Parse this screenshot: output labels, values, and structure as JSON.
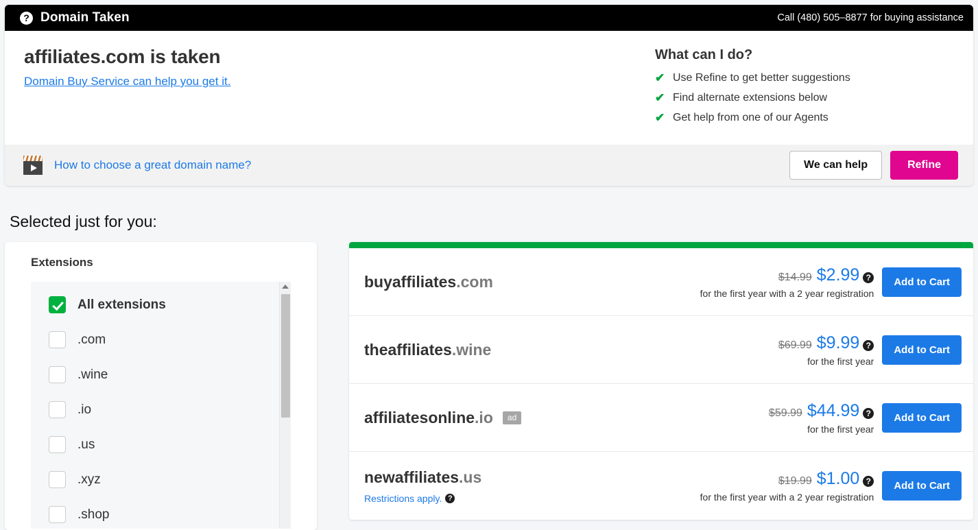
{
  "header": {
    "icon": "question-circle-icon",
    "title": "Domain Taken",
    "phone_text": "Call (480) 505–8877 for buying assistance"
  },
  "hero": {
    "heading": "affiliates.com is taken",
    "sub_link": "Domain Buy Service can help you get it.",
    "what_title": "What can I do?",
    "what_items": [
      "Use Refine to get better suggestions",
      "Find alternate extensions below",
      "Get help from one of our Agents"
    ],
    "check_glyph": "✔"
  },
  "video_bar": {
    "icon": "clapperboard-play-icon",
    "link_text": "How to choose a great domain name?",
    "help_button": "We can help",
    "refine_button": "Refine"
  },
  "results": {
    "section_title": "Selected just for you:",
    "extensions_title": "Extensions",
    "extensions": [
      {
        "label": "All extensions",
        "checked": true
      },
      {
        "label": ".com",
        "checked": false
      },
      {
        "label": ".wine",
        "checked": false
      },
      {
        "label": ".io",
        "checked": false
      },
      {
        "label": ".us",
        "checked": false
      },
      {
        "label": ".xyz",
        "checked": false
      },
      {
        "label": ".shop",
        "checked": false
      }
    ],
    "add_to_cart_label": "Add to Cart",
    "help_glyph": "?",
    "rows": [
      {
        "sld": "buyaffiliates",
        "tld": ".com",
        "ad": false,
        "restrictions": "",
        "price_old": "$14.99",
        "price_new": "$2.99",
        "term": "for the first year with a 2 year registration"
      },
      {
        "sld": "theaffiliates",
        "tld": ".wine",
        "ad": false,
        "restrictions": "",
        "price_old": "$69.99",
        "price_new": "$9.99",
        "term": "for the first year"
      },
      {
        "sld": "affiliatesonline",
        "tld": ".io",
        "ad": true,
        "ad_label": "ad",
        "restrictions": "",
        "price_old": "$59.99",
        "price_new": "$44.99",
        "term": "for the first year"
      },
      {
        "sld": "newaffiliates",
        "tld": ".us",
        "ad": false,
        "restrictions": "Restrictions apply.",
        "price_old": "$19.99",
        "price_new": "$1.00",
        "term": "for the first year with a 2 year registration"
      }
    ]
  },
  "colors": {
    "accent_blue": "#1c7ae7",
    "accent_pink": "#e0068f",
    "accent_green": "#00a63f",
    "checkbox_green": "#00b140",
    "page_bg": "#f4f6f7"
  }
}
